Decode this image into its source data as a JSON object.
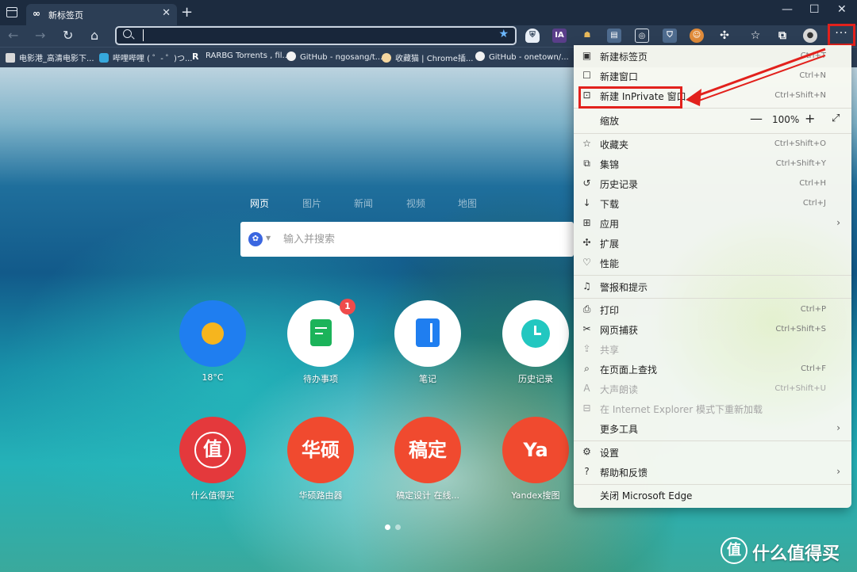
{
  "tab": {
    "title": "新标签页"
  },
  "address_bar": {
    "value": ""
  },
  "bookmarks": [
    "电影港_高清电影下...",
    "哔哩哔哩 ( ゜- ゜)つ...",
    "RARBG Torrents , fil...",
    "GitHub - ngosang/t...",
    "收藏猫 | Chrome插...",
    "GitHub - onetown/..."
  ],
  "search": {
    "tabs": [
      "网页",
      "图片",
      "新闻",
      "视频",
      "地图"
    ],
    "placeholder": "输入并搜索"
  },
  "tiles_row1": [
    {
      "label": "18°C",
      "color": "#1f7ef0"
    },
    {
      "label": "待办事项",
      "color": "#ffffff",
      "badge": "1"
    },
    {
      "label": "笔记",
      "color": "#ffffff"
    },
    {
      "label": "历史记录",
      "color": "#ffffff"
    }
  ],
  "tiles_row2": [
    {
      "label": "什么值得买",
      "text": "值",
      "color": "#e4393c"
    },
    {
      "label": "华硕路由器",
      "text": "华硕",
      "color": "#f04a2f"
    },
    {
      "label": "稿定设计 在线...",
      "text": "稿定",
      "color": "#f04a2f"
    },
    {
      "label": "Yandex搜图",
      "text": "Ya",
      "color": "#f04a2f"
    }
  ],
  "menu": {
    "new_tab": {
      "label": "新建标签页",
      "shortcut": "Ctrl+T"
    },
    "new_window": {
      "label": "新建窗口",
      "shortcut": "Ctrl+N"
    },
    "new_inprivate": {
      "label": "新建 InPrivate 窗口",
      "shortcut": "Ctrl+Shift+N"
    },
    "zoom": {
      "label": "缩放",
      "value": "100%"
    },
    "favorites": {
      "label": "收藏夹",
      "shortcut": "Ctrl+Shift+O"
    },
    "collections": {
      "label": "集锦",
      "shortcut": "Ctrl+Shift+Y"
    },
    "history": {
      "label": "历史记录",
      "shortcut": "Ctrl+H"
    },
    "downloads": {
      "label": "下载",
      "shortcut": "Ctrl+J"
    },
    "apps": {
      "label": "应用"
    },
    "extensions": {
      "label": "扩展"
    },
    "performance": {
      "label": "性能"
    },
    "alerts": {
      "label": "警报和提示"
    },
    "print": {
      "label": "打印",
      "shortcut": "Ctrl+P"
    },
    "web_capture": {
      "label": "网页捕获",
      "shortcut": "Ctrl+Shift+S"
    },
    "share": {
      "label": "共享"
    },
    "find": {
      "label": "在页面上查找",
      "shortcut": "Ctrl+F"
    },
    "read_aloud": {
      "label": "大声朗读",
      "shortcut": "Ctrl+Shift+U"
    },
    "ie_mode": {
      "label": "在 Internet Explorer 模式下重新加载"
    },
    "more_tools": {
      "label": "更多工具"
    },
    "settings": {
      "label": "设置"
    },
    "help": {
      "label": "帮助和反馈"
    },
    "close": {
      "label": "关闭 Microsoft Edge"
    }
  },
  "watermark": {
    "logo": "值",
    "text": "什么值得买"
  },
  "colors": {
    "highlight": "#e2211c",
    "titlebar": "#1c2b3f",
    "toolbar": "#2c3e55"
  }
}
